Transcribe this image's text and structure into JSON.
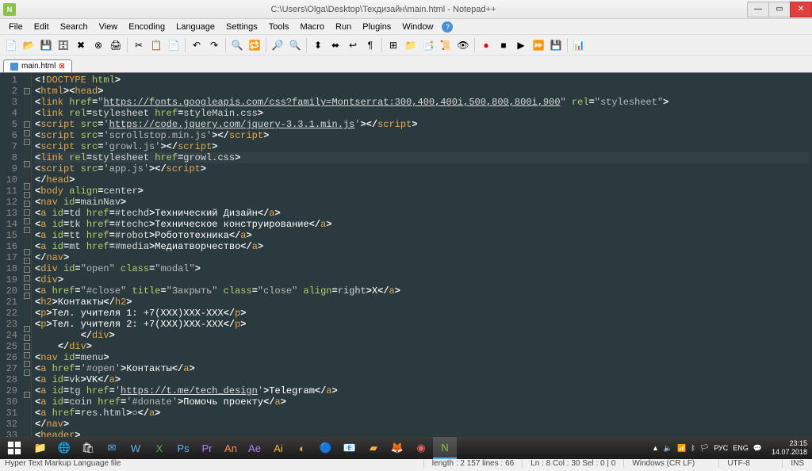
{
  "titlebar": {
    "title": "C:\\Users\\Olga\\Desktop\\Техдизайн\\main.html - Notepad++"
  },
  "menu": [
    "File",
    "Edit",
    "Search",
    "View",
    "Encoding",
    "Language",
    "Settings",
    "Tools",
    "Macro",
    "Run",
    "Plugins",
    "Window",
    "?"
  ],
  "tab": {
    "label": "main.html"
  },
  "code_lines": [
    {
      "n": 1,
      "f": "",
      "tokens": [
        [
          "br",
          "<!"
        ],
        [
          "tag",
          "DOCTYPE "
        ],
        [
          "attr",
          "html"
        ],
        [
          "br",
          ">"
        ]
      ]
    },
    {
      "n": 2,
      "f": "box",
      "tokens": [
        [
          "br",
          "<"
        ],
        [
          "tag",
          "html"
        ],
        [
          "br",
          "><"
        ],
        [
          "tag",
          "head"
        ],
        [
          "br",
          ">"
        ]
      ]
    },
    {
      "n": 3,
      "f": "",
      "tokens": [
        [
          "br",
          "<"
        ],
        [
          "tag",
          "link "
        ],
        [
          "attr",
          "href"
        ],
        [
          "br",
          "="
        ],
        [
          "str",
          "\""
        ],
        [
          "url",
          "https://fonts.googleapis.com/css?family=Montserrat:300,400,400i,500,800,800i,900"
        ],
        [
          "str",
          "\""
        ],
        [
          "attr",
          " rel"
        ],
        [
          "br",
          "="
        ],
        [
          "str",
          "\"stylesheet\""
        ],
        [
          "br",
          ">"
        ]
      ]
    },
    {
      "n": 4,
      "f": "",
      "tokens": [
        [
          "br",
          "<"
        ],
        [
          "tag",
          "link "
        ],
        [
          "attr",
          "rel"
        ],
        [
          "br",
          "="
        ],
        [
          "val",
          "stylesheet "
        ],
        [
          "attr",
          "href"
        ],
        [
          "br",
          "="
        ],
        [
          "val",
          "styleMain.css"
        ],
        [
          "br",
          ">"
        ]
      ]
    },
    {
      "n": 5,
      "f": "box",
      "tokens": [
        [
          "br",
          "<"
        ],
        [
          "tag",
          "script "
        ],
        [
          "attr",
          "src"
        ],
        [
          "br",
          "="
        ],
        [
          "str",
          "'"
        ],
        [
          "url",
          "https://code.jquery.com/jquery-3.3.1.min.js"
        ],
        [
          "str",
          "'"
        ],
        [
          "br",
          "></"
        ],
        [
          "tag",
          "script"
        ],
        [
          "br",
          ">"
        ]
      ]
    },
    {
      "n": 6,
      "f": "box",
      "tokens": [
        [
          "br",
          "<"
        ],
        [
          "tag",
          "script "
        ],
        [
          "attr",
          "src"
        ],
        [
          "br",
          "="
        ],
        [
          "str",
          "'scrollstop.min.js'"
        ],
        [
          "br",
          "></"
        ],
        [
          "tag",
          "script"
        ],
        [
          "br",
          ">"
        ]
      ]
    },
    {
      "n": 7,
      "f": "box",
      "tokens": [
        [
          "br",
          "<"
        ],
        [
          "tag",
          "script "
        ],
        [
          "attr",
          "src"
        ],
        [
          "br",
          "="
        ],
        [
          "str",
          "'growl.js'"
        ],
        [
          "br",
          "></"
        ],
        [
          "tag",
          "script"
        ],
        [
          "br",
          ">"
        ]
      ]
    },
    {
      "n": 8,
      "f": "",
      "hl": true,
      "tokens": [
        [
          "br",
          "<"
        ],
        [
          "tag",
          "link "
        ],
        [
          "attr",
          "rel"
        ],
        [
          "br",
          "="
        ],
        [
          "val",
          "stylesheet "
        ],
        [
          "attr",
          "href"
        ],
        [
          "br",
          "="
        ],
        [
          "val",
          "growl.css"
        ],
        [
          "br",
          ">"
        ]
      ]
    },
    {
      "n": 9,
      "f": "box",
      "tokens": [
        [
          "br",
          "<"
        ],
        [
          "tag",
          "script "
        ],
        [
          "attr",
          "src"
        ],
        [
          "br",
          "="
        ],
        [
          "str",
          "'app.js'"
        ],
        [
          "br",
          "></"
        ],
        [
          "tag",
          "script"
        ],
        [
          "br",
          ">"
        ]
      ]
    },
    {
      "n": 10,
      "f": "",
      "tokens": [
        [
          "br",
          "</"
        ],
        [
          "tag",
          "head"
        ],
        [
          "br",
          ">"
        ]
      ]
    },
    {
      "n": 11,
      "f": "box",
      "tokens": [
        [
          "br",
          "<"
        ],
        [
          "tag",
          "body "
        ],
        [
          "attr",
          "align"
        ],
        [
          "br",
          "="
        ],
        [
          "val",
          "center"
        ],
        [
          "br",
          ">"
        ]
      ]
    },
    {
      "n": 12,
      "f": "box",
      "tokens": [
        [
          "br",
          "<"
        ],
        [
          "tag",
          "nav "
        ],
        [
          "attr",
          "id"
        ],
        [
          "br",
          "="
        ],
        [
          "val",
          "mainNav"
        ],
        [
          "br",
          ">"
        ]
      ]
    },
    {
      "n": 13,
      "f": "box",
      "tokens": [
        [
          "br",
          "<"
        ],
        [
          "tag",
          "a "
        ],
        [
          "attr",
          "id"
        ],
        [
          "br",
          "="
        ],
        [
          "val",
          "td "
        ],
        [
          "attr",
          "href"
        ],
        [
          "br",
          "="
        ],
        [
          "val",
          "#techd"
        ],
        [
          "br",
          ">"
        ],
        [
          "text",
          "Технический Дизайн"
        ],
        [
          "br",
          "</"
        ],
        [
          "tag",
          "a"
        ],
        [
          "br",
          ">"
        ]
      ]
    },
    {
      "n": 14,
      "f": "box",
      "tokens": [
        [
          "br",
          "<"
        ],
        [
          "tag",
          "a "
        ],
        [
          "attr",
          "id"
        ],
        [
          "br",
          "="
        ],
        [
          "val",
          "tk "
        ],
        [
          "attr",
          "href"
        ],
        [
          "br",
          "="
        ],
        [
          "val",
          "#techc"
        ],
        [
          "br",
          ">"
        ],
        [
          "text",
          "Техническое конструирование"
        ],
        [
          "br",
          "</"
        ],
        [
          "tag",
          "a"
        ],
        [
          "br",
          ">"
        ]
      ]
    },
    {
      "n": 15,
      "f": "box",
      "tokens": [
        [
          "br",
          "<"
        ],
        [
          "tag",
          "a "
        ],
        [
          "attr",
          "id"
        ],
        [
          "br",
          "="
        ],
        [
          "val",
          "tt "
        ],
        [
          "attr",
          "href"
        ],
        [
          "br",
          "="
        ],
        [
          "val",
          "#robot"
        ],
        [
          "br",
          ">"
        ],
        [
          "text",
          "Робототехника"
        ],
        [
          "br",
          "</"
        ],
        [
          "tag",
          "a"
        ],
        [
          "br",
          ">"
        ]
      ]
    },
    {
      "n": 16,
      "f": "box",
      "tokens": [
        [
          "br",
          "<"
        ],
        [
          "tag",
          "a "
        ],
        [
          "attr",
          "id"
        ],
        [
          "br",
          "="
        ],
        [
          "val",
          "mt "
        ],
        [
          "attr",
          "href"
        ],
        [
          "br",
          "="
        ],
        [
          "val",
          "#media"
        ],
        [
          "br",
          ">"
        ],
        [
          "text",
          "Медиатворчество"
        ],
        [
          "br",
          "</"
        ],
        [
          "tag",
          "a"
        ],
        [
          "br",
          ">"
        ]
      ]
    },
    {
      "n": 17,
      "f": "",
      "tokens": [
        [
          "br",
          "</"
        ],
        [
          "tag",
          "nav"
        ],
        [
          "br",
          ">"
        ]
      ]
    },
    {
      "n": 18,
      "f": "box",
      "tokens": [
        [
          "br",
          "<"
        ],
        [
          "tag",
          "div "
        ],
        [
          "attr",
          "id"
        ],
        [
          "br",
          "="
        ],
        [
          "str",
          "\"open\" "
        ],
        [
          "attr",
          "class"
        ],
        [
          "br",
          "="
        ],
        [
          "str",
          "\"modal\""
        ],
        [
          "br",
          ">"
        ]
      ]
    },
    {
      "n": 19,
      "f": "box",
      "tokens": [
        [
          "br",
          "<"
        ],
        [
          "tag",
          "div"
        ],
        [
          "br",
          ">"
        ]
      ]
    },
    {
      "n": 20,
      "f": "box",
      "tokens": [
        [
          "br",
          "<"
        ],
        [
          "tag",
          "a "
        ],
        [
          "attr",
          "href"
        ],
        [
          "br",
          "="
        ],
        [
          "str",
          "\"#close\" "
        ],
        [
          "attr",
          "title"
        ],
        [
          "br",
          "="
        ],
        [
          "str",
          "\"Закрыть\" "
        ],
        [
          "attr",
          "class"
        ],
        [
          "br",
          "="
        ],
        [
          "str",
          "\"close\" "
        ],
        [
          "attr",
          "align"
        ],
        [
          "br",
          "="
        ],
        [
          "val",
          "right"
        ],
        [
          "br",
          ">"
        ],
        [
          "text",
          "X"
        ],
        [
          "br",
          "</"
        ],
        [
          "tag",
          "a"
        ],
        [
          "br",
          ">"
        ]
      ]
    },
    {
      "n": 21,
      "f": "box",
      "tokens": [
        [
          "br",
          "<"
        ],
        [
          "tag",
          "h2"
        ],
        [
          "br",
          ">"
        ],
        [
          "text",
          "Контакты"
        ],
        [
          "br",
          "</"
        ],
        [
          "tag",
          "h2"
        ],
        [
          "br",
          ">"
        ]
      ]
    },
    {
      "n": 22,
      "f": "box",
      "tokens": [
        [
          "br",
          "<"
        ],
        [
          "tag",
          "p"
        ],
        [
          "br",
          ">"
        ],
        [
          "text",
          "Тел. учителя 1: +7(XXX)XXX-XXX"
        ],
        [
          "br",
          "</"
        ],
        [
          "tag",
          "p"
        ],
        [
          "br",
          ">"
        ]
      ]
    },
    {
      "n": 23,
      "f": "box",
      "tokens": [
        [
          "br",
          "<"
        ],
        [
          "tag",
          "p"
        ],
        [
          "br",
          ">"
        ],
        [
          "text",
          "Тел. учителя 2: +7(XXX)XXX-XXX"
        ],
        [
          "br",
          "</"
        ],
        [
          "tag",
          "p"
        ],
        [
          "br",
          ">"
        ]
      ]
    },
    {
      "n": 24,
      "f": "",
      "tokens": [
        [
          "text",
          "        "
        ],
        [
          "br",
          "</"
        ],
        [
          "tag",
          "div"
        ],
        [
          "br",
          ">"
        ]
      ]
    },
    {
      "n": 25,
      "f": "",
      "tokens": [
        [
          "text",
          "    "
        ],
        [
          "br",
          "</"
        ],
        [
          "tag",
          "div"
        ],
        [
          "br",
          ">"
        ]
      ]
    },
    {
      "n": 26,
      "f": "box",
      "tokens": [
        [
          "br",
          "<"
        ],
        [
          "tag",
          "nav "
        ],
        [
          "attr",
          "id"
        ],
        [
          "br",
          "="
        ],
        [
          "val",
          "menu"
        ],
        [
          "br",
          ">"
        ]
      ]
    },
    {
      "n": 27,
      "f": "box",
      "tokens": [
        [
          "br",
          "<"
        ],
        [
          "tag",
          "a "
        ],
        [
          "attr",
          "href"
        ],
        [
          "br",
          "="
        ],
        [
          "str",
          "'#open'"
        ],
        [
          "br",
          ">"
        ],
        [
          "text",
          "Контакты"
        ],
        [
          "br",
          "</"
        ],
        [
          "tag",
          "a"
        ],
        [
          "br",
          ">"
        ]
      ]
    },
    {
      "n": 28,
      "f": "box",
      "tokens": [
        [
          "br",
          "<"
        ],
        [
          "tag",
          "a "
        ],
        [
          "attr",
          "id"
        ],
        [
          "br",
          "="
        ],
        [
          "val",
          "vk"
        ],
        [
          "br",
          ">"
        ],
        [
          "text",
          "VK"
        ],
        [
          "br",
          "</"
        ],
        [
          "tag",
          "a"
        ],
        [
          "br",
          ">"
        ]
      ]
    },
    {
      "n": 29,
      "f": "box",
      "tokens": [
        [
          "br",
          "<"
        ],
        [
          "tag",
          "a "
        ],
        [
          "attr",
          "id"
        ],
        [
          "br",
          "="
        ],
        [
          "val",
          "tg "
        ],
        [
          "attr",
          "href"
        ],
        [
          "br",
          "="
        ],
        [
          "str",
          "'"
        ],
        [
          "url",
          "https://t.me/tech_design"
        ],
        [
          "str",
          "'"
        ],
        [
          "br",
          ">"
        ],
        [
          "text",
          "Telegram"
        ],
        [
          "br",
          "</"
        ],
        [
          "tag",
          "a"
        ],
        [
          "br",
          ">"
        ]
      ]
    },
    {
      "n": 30,
      "f": "box",
      "tokens": [
        [
          "br",
          "<"
        ],
        [
          "tag",
          "a "
        ],
        [
          "attr",
          "id"
        ],
        [
          "br",
          "="
        ],
        [
          "val",
          "coin "
        ],
        [
          "attr",
          "href"
        ],
        [
          "br",
          "="
        ],
        [
          "str",
          "'#donate'"
        ],
        [
          "br",
          ">"
        ],
        [
          "text",
          "Помочь проекту"
        ],
        [
          "br",
          "</"
        ],
        [
          "tag",
          "a"
        ],
        [
          "br",
          ">"
        ]
      ]
    },
    {
      "n": 31,
      "f": "box",
      "tokens": [
        [
          "br",
          "<"
        ],
        [
          "tag",
          "a "
        ],
        [
          "attr",
          "href"
        ],
        [
          "br",
          "="
        ],
        [
          "val",
          "res.html"
        ],
        [
          "br",
          ">"
        ],
        [
          "text",
          "○"
        ],
        [
          "br",
          "</"
        ],
        [
          "tag",
          "a"
        ],
        [
          "br",
          ">"
        ]
      ]
    },
    {
      "n": 32,
      "f": "",
      "tokens": [
        [
          "br",
          "</"
        ],
        [
          "tag",
          "nav"
        ],
        [
          "br",
          ">"
        ]
      ]
    },
    {
      "n": 33,
      "f": "box",
      "tokens": [
        [
          "br",
          "<"
        ],
        [
          "tag",
          "header"
        ],
        [
          "br",
          ">"
        ]
      ]
    }
  ],
  "status": {
    "filetype": "Hyper Text Markup Language file",
    "length": "length : 2 157    lines : 66",
    "pos": "Ln : 8    Col : 30    Sel : 0 | 0",
    "eol": "Windows (CR LF)",
    "enc": "UTF-8",
    "mode": "INS"
  },
  "tray": {
    "time": "23:15",
    "date": "14.07.2018",
    "lang": "ENG",
    "kbd": "РУС"
  }
}
